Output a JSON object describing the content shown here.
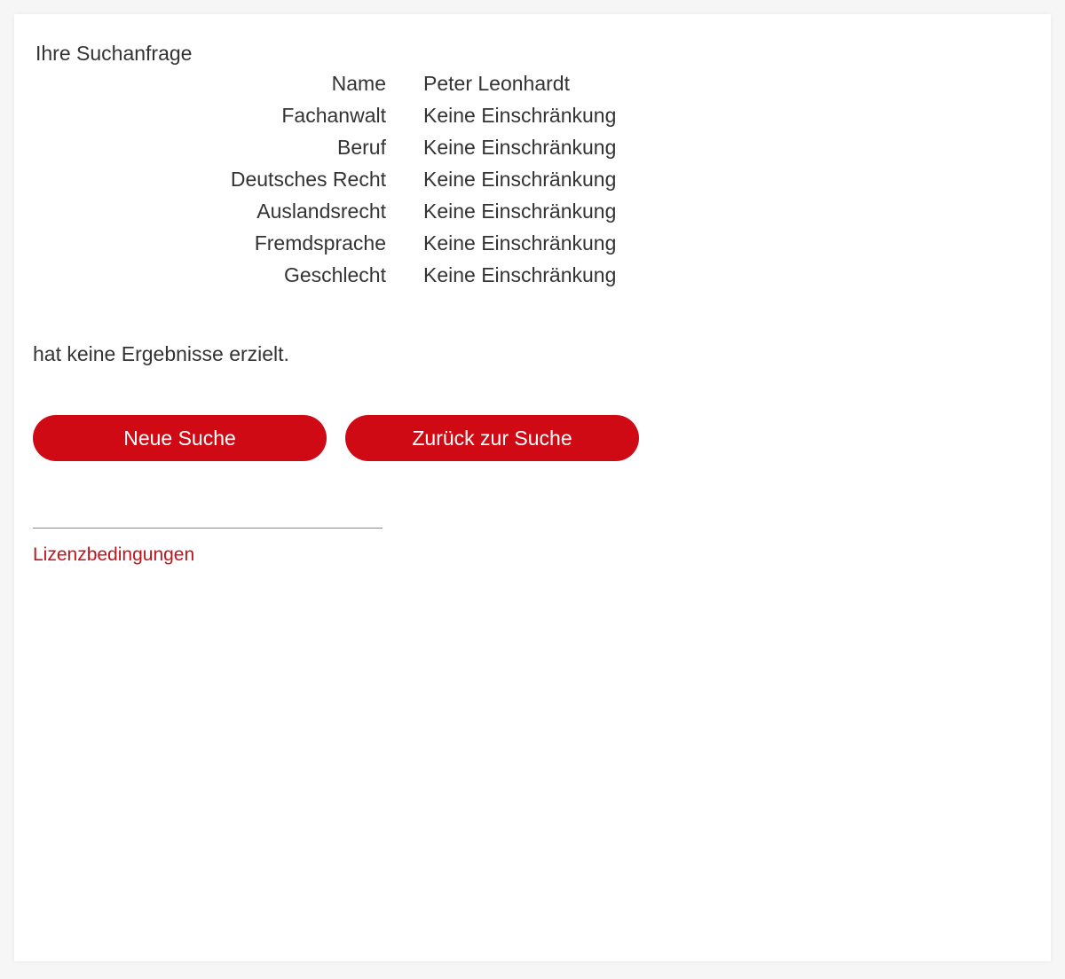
{
  "query": {
    "heading": "Ihre Suchanfrage",
    "criteria": [
      {
        "label": "Name",
        "value": "Peter Leonhardt"
      },
      {
        "label": "Fachanwalt",
        "value": "Keine Einschränkung"
      },
      {
        "label": "Beruf",
        "value": "Keine Einschränkung"
      },
      {
        "label": "Deutsches Recht",
        "value": "Keine Einschränkung"
      },
      {
        "label": "Auslandsrecht",
        "value": "Keine Einschränkung"
      },
      {
        "label": "Fremdsprache",
        "value": "Keine Einschränkung"
      },
      {
        "label": "Geschlecht",
        "value": "Keine Einschränkung"
      }
    ]
  },
  "result": {
    "message": "hat keine Ergebnisse erzielt."
  },
  "actions": {
    "new_search_label": "Neue Suche",
    "back_to_search_label": "Zurück zur Suche"
  },
  "footer": {
    "license_link": "Lizenzbedingungen"
  },
  "colors": {
    "accent": "#cf0a14",
    "link": "#c0141c",
    "text": "#333333"
  }
}
